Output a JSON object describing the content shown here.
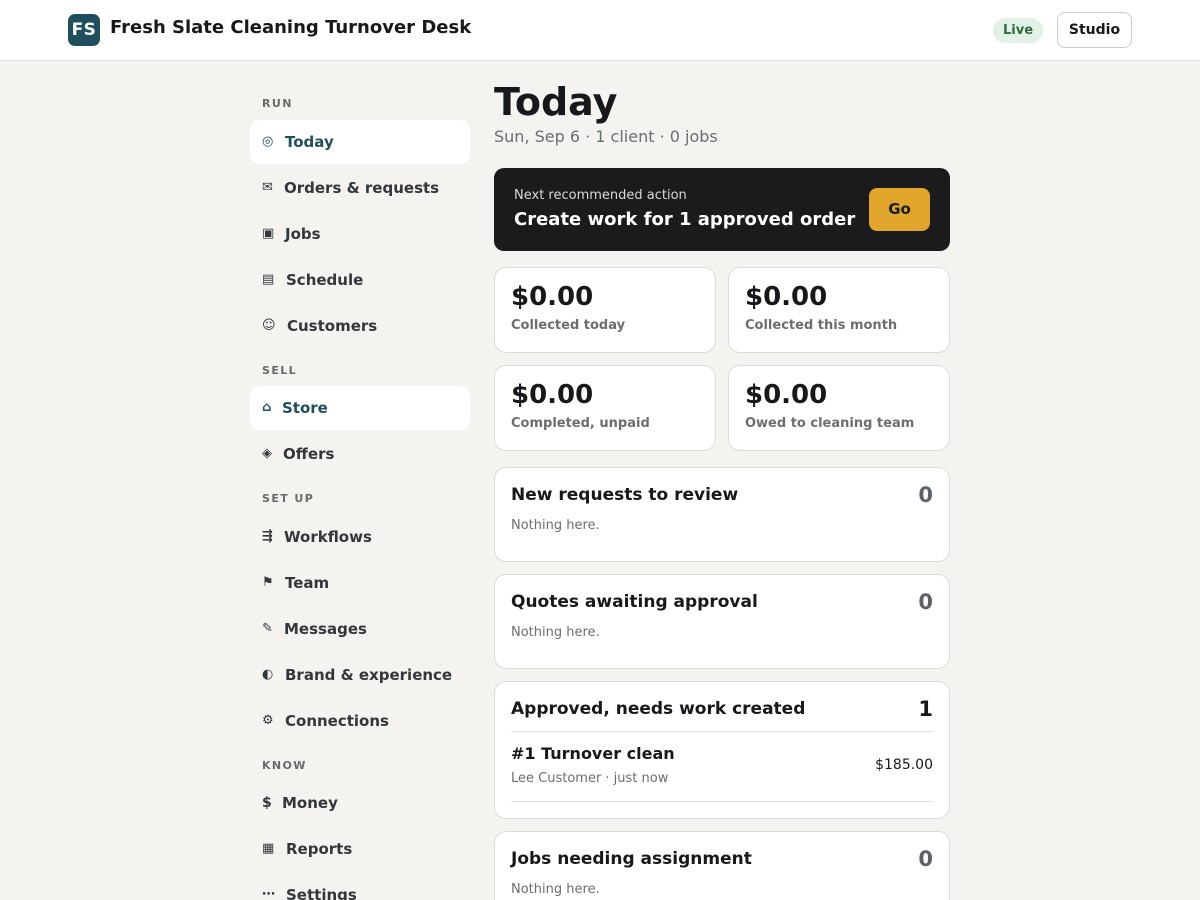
{
  "header": {
    "logo_initials": "FS",
    "app_title": "Fresh Slate Cleaning Turnover Desk",
    "status_badge": "Live",
    "studio_button": "Studio"
  },
  "sidebar": {
    "sections": [
      {
        "label": "RUN"
      },
      {
        "label": "SELL"
      },
      {
        "label": "SET UP"
      },
      {
        "label": "KNOW"
      }
    ],
    "items": [
      {
        "label": "Today",
        "icon": "◎",
        "icon_name": "target-icon",
        "active": true
      },
      {
        "label": "Orders & requests",
        "icon": "✉",
        "icon_name": "envelope-icon",
        "active": false
      },
      {
        "label": "Jobs",
        "icon": "▣",
        "icon_name": "square-icon",
        "active": false
      },
      {
        "label": "Schedule",
        "icon": "▤",
        "icon_name": "calendar-icon",
        "active": false
      },
      {
        "label": "Customers",
        "icon": "☺",
        "icon_name": "smiley-icon",
        "active": false
      },
      {
        "label": "Store",
        "icon": "⌂",
        "icon_name": "store-icon",
        "active": true
      },
      {
        "label": "Offers",
        "icon": "◈",
        "icon_name": "diamond-icon",
        "active": false
      },
      {
        "label": "Workflows",
        "icon": "⇶",
        "icon_name": "workflow-icon",
        "active": false
      },
      {
        "label": "Team",
        "icon": "⚑",
        "icon_name": "flag-icon",
        "active": false
      },
      {
        "label": "Messages",
        "icon": "✎",
        "icon_name": "pencil-icon",
        "active": false
      },
      {
        "label": "Brand & experience",
        "icon": "◐",
        "icon_name": "half-circle-icon",
        "active": false
      },
      {
        "label": "Connections",
        "icon": "⚙",
        "icon_name": "gear-icon",
        "active": false
      },
      {
        "label": "Money",
        "icon": "$",
        "icon_name": "dollar-icon",
        "active": false
      },
      {
        "label": "Reports",
        "icon": "▦",
        "icon_name": "grid-icon",
        "active": false
      },
      {
        "label": "Settings",
        "icon": "⋯",
        "icon_name": "more-icon",
        "active": false
      }
    ]
  },
  "main": {
    "title": "Today",
    "subtitle": "Sun, Sep 6 · 1 client · 0 jobs",
    "action": {
      "kicker": "Next recommended action",
      "title": "Create work for 1 approved order",
      "button": "Go"
    },
    "stats": [
      {
        "value": "$0.00",
        "label": "Collected today"
      },
      {
        "value": "$0.00",
        "label": "Collected this month"
      },
      {
        "value": "$0.00",
        "label": "Completed, unpaid"
      },
      {
        "value": "$0.00",
        "label": "Owed to cleaning team"
      }
    ],
    "panels": {
      "new_requests": {
        "title": "New requests to review",
        "count": "0",
        "empty": "Nothing here."
      },
      "quotes": {
        "title": "Quotes awaiting approval",
        "count": "0",
        "empty": "Nothing here."
      },
      "approved": {
        "title": "Approved, needs work created",
        "count": "1",
        "orders": [
          {
            "title": "#1 Turnover clean",
            "meta": "Lee Customer · just now",
            "amount": "$185.00"
          }
        ]
      },
      "jobs_assignment": {
        "title": "Jobs needing assignment",
        "count": "0",
        "empty": "Nothing here."
      }
    }
  },
  "colors": {
    "brand": "#1f4e5c",
    "accent": "#e2a52c",
    "action_bg": "#1b1b1e",
    "live_bg": "#e3f0e6",
    "live_text": "#2f6b3f",
    "page_bg": "#f4f3f0"
  }
}
